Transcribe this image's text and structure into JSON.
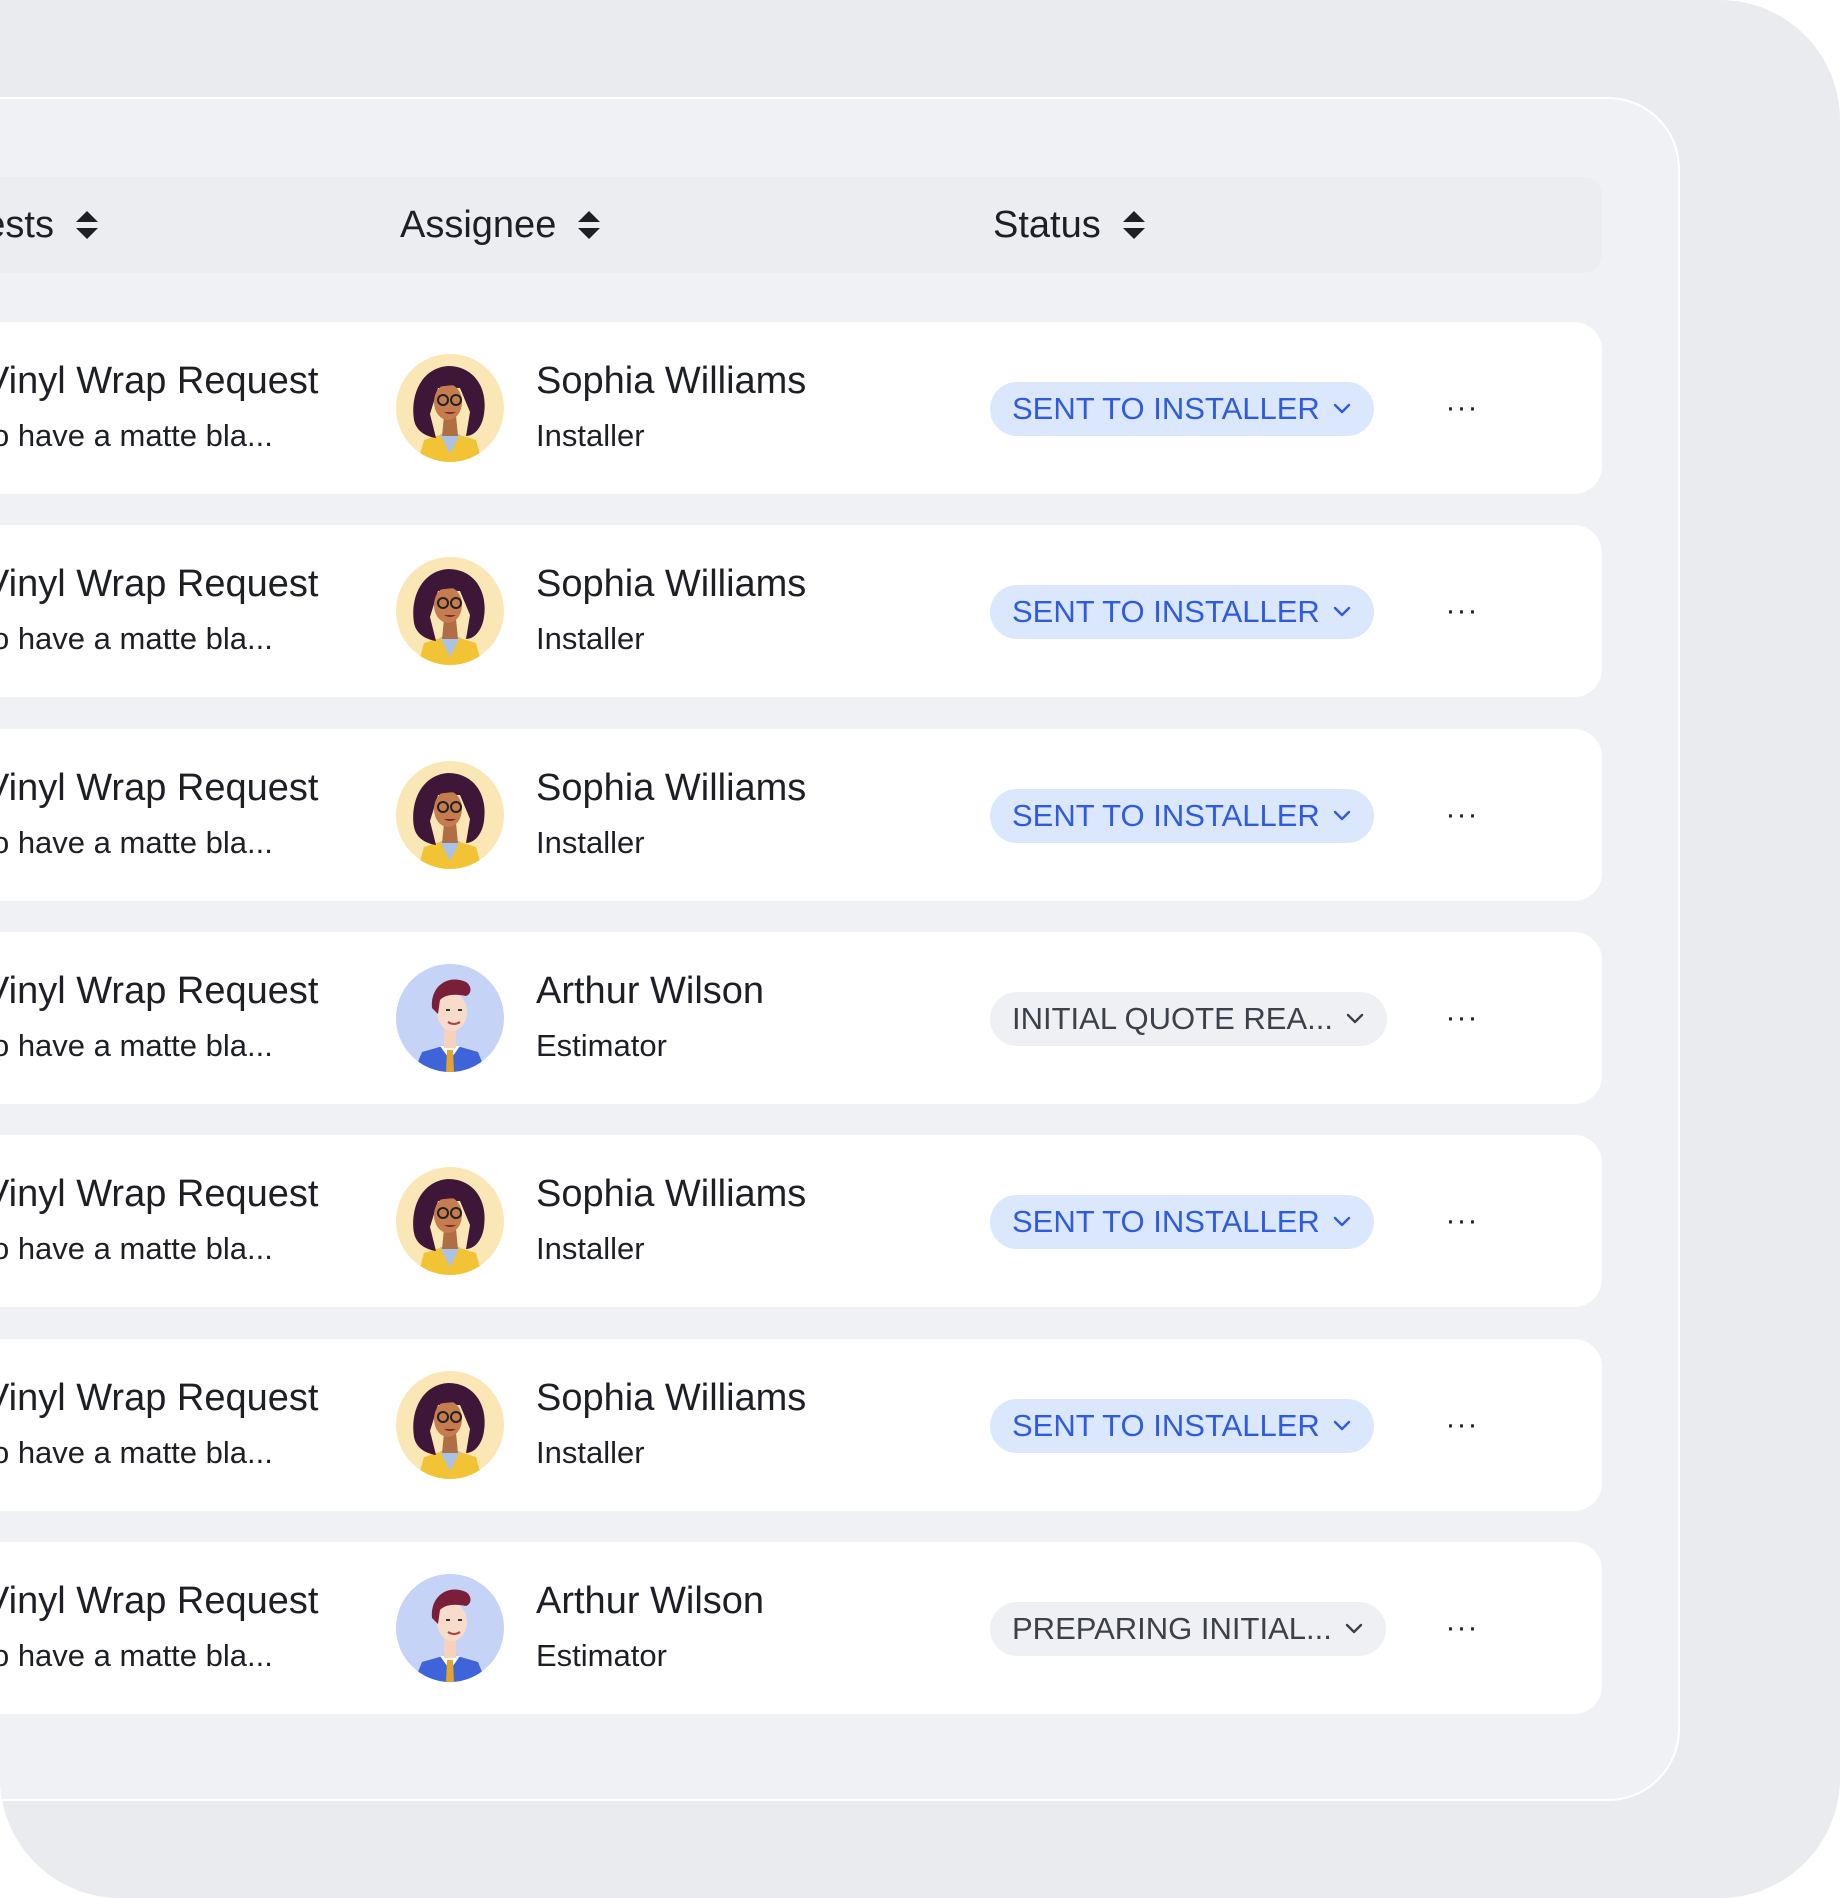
{
  "table": {
    "headers": {
      "requests": "quests",
      "assignee": "Assignee",
      "status": "Status"
    },
    "rows": [
      {
        "title": "Vinyl Wrap Request",
        "subtitle": "ke to have a matte bla...",
        "assignee": "Sophia Williams",
        "role": "Installer",
        "avatar": "sophia",
        "status": "SENT TO INSTALLER",
        "status_style": "blue"
      },
      {
        "title": "Vinyl Wrap Request",
        "subtitle": "ke to have a matte bla...",
        "assignee": "Sophia Williams",
        "role": "Installer",
        "avatar": "sophia",
        "status": "SENT TO INSTALLER",
        "status_style": "blue"
      },
      {
        "title": "Vinyl Wrap Request",
        "subtitle": "ke to have a matte bla...",
        "assignee": "Sophia Williams",
        "role": "Installer",
        "avatar": "sophia",
        "status": "SENT TO INSTALLER",
        "status_style": "blue"
      },
      {
        "title": "Vinyl Wrap Request",
        "subtitle": "ke to have a matte bla...",
        "assignee": "Arthur Wilson",
        "role": "Estimator",
        "avatar": "arthur",
        "status": "INITIAL QUOTE REA...",
        "status_style": "gray"
      },
      {
        "title": "Vinyl Wrap Request",
        "subtitle": "ke to have a matte bla...",
        "assignee": "Sophia Williams",
        "role": "Installer",
        "avatar": "sophia",
        "status": "SENT TO INSTALLER",
        "status_style": "blue"
      },
      {
        "title": "Vinyl Wrap Request",
        "subtitle": "ke to have a matte bla...",
        "assignee": "Sophia Williams",
        "role": "Installer",
        "avatar": "sophia",
        "status": "SENT TO INSTALLER",
        "status_style": "blue"
      },
      {
        "title": "Vinyl Wrap Request",
        "subtitle": "ke to have a matte bla...",
        "assignee": "Arthur Wilson",
        "role": "Estimator",
        "avatar": "arthur",
        "status": "PREPARING INITIAL...",
        "status_style": "gray"
      }
    ],
    "more_label": "···"
  },
  "colors": {
    "status_blue_bg": "#dbe7fd",
    "status_blue_text": "#2f5be0",
    "status_gray_bg": "#eff0f3",
    "status_gray_text": "#3d4048"
  },
  "icons": {
    "sort": "sort-icon",
    "chevron": "chevron-down-icon",
    "more": "more-icon"
  }
}
